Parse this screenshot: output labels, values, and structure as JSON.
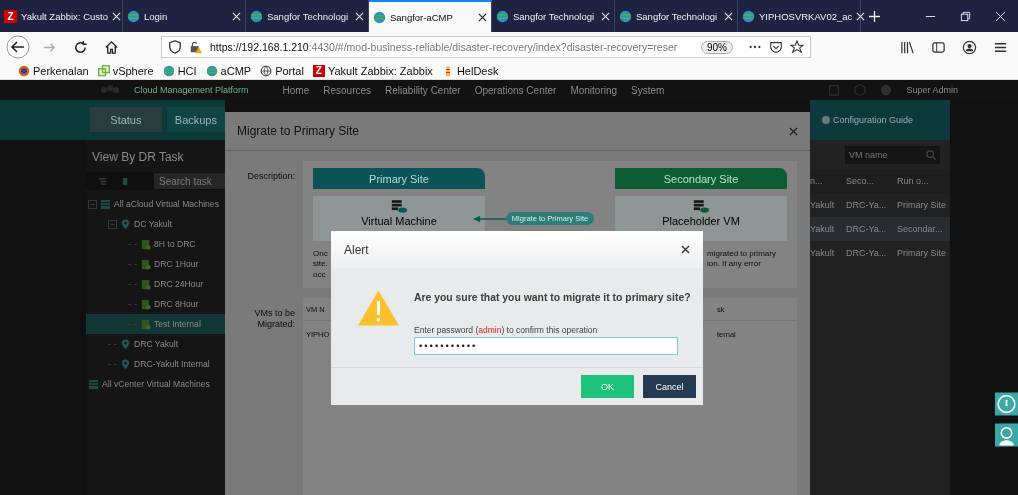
{
  "browser": {
    "tabs": [
      {
        "title": "Yakult Zabbix: Custo",
        "letter": "Z",
        "selected": false
      },
      {
        "title": "Login",
        "selected": false
      },
      {
        "title": "Sangfor Technologi",
        "selected": false
      },
      {
        "title": "Sangfor-aCMP",
        "selected": true
      },
      {
        "title": "Sangfor Technologi",
        "selected": false
      },
      {
        "title": "Sangfor Technologi",
        "selected": false
      },
      {
        "title": "YIPHOSVRKAV02_ac",
        "selected": false
      }
    ],
    "url_host": "https://192.168.1.210",
    "url_rest": ":4430/#/mod-business-reliable/disaster-recovery/index?disaster-recovery=reser",
    "zoom": "90%",
    "bookmarks": [
      {
        "label": "Perkenalan"
      },
      {
        "label": "vSphere"
      },
      {
        "label": "HCI"
      },
      {
        "label": "aCMP"
      },
      {
        "label": "Portal"
      },
      {
        "label": "Yakult Zabbix: Zabbix",
        "letter": "Z"
      },
      {
        "label": "HelDesk"
      }
    ]
  },
  "app": {
    "brand_subtitle": "Cloud Management Platform",
    "nav": [
      "Home",
      "Resources",
      "Reliability Center",
      "Operations Center",
      "Monitoring",
      "System"
    ],
    "user": "Super Admin",
    "tabs": [
      {
        "label": "Status",
        "selected": true
      },
      {
        "label": "Backups",
        "selected": false
      }
    ],
    "guide": "Configuration Guide",
    "panel_title": "View By DR Task",
    "search_placeholder": "Search task",
    "tree": [
      {
        "label": "All aCloud Virtual Machines",
        "kind": "group",
        "selected": false,
        "children": [
          {
            "label": "DC Yakult",
            "kind": "site",
            "selected": false,
            "children": [
              {
                "label": "8H to DRC",
                "kind": "task",
                "selected": false
              },
              {
                "label": "DRC 1Hour",
                "kind": "task",
                "selected": false
              },
              {
                "label": "DRC 24Hour",
                "kind": "task",
                "selected": false
              },
              {
                "label": "DRC 8Hour",
                "kind": "task",
                "selected": false
              },
              {
                "label": "Test Internal",
                "kind": "task",
                "selected": true
              }
            ]
          },
          {
            "label": "DRC Yakult",
            "kind": "site",
            "selected": false
          },
          {
            "label": "DRC-Yakult Internal",
            "kind": "site",
            "selected": false
          }
        ]
      },
      {
        "label": "All vCenter Virtual Machines",
        "kind": "group",
        "selected": false
      }
    ],
    "table": {
      "search_placeholder": "VM name",
      "columns": [
        "n...",
        "Seco...",
        "Run o..."
      ],
      "rows": [
        {
          "cells": [
            "Yakult",
            "DRC-Ya...",
            "Primary Site"
          ],
          "selected": false
        },
        {
          "cells": [
            "Yakult",
            "DRC-Ya...",
            "Secondar..."
          ],
          "selected": true
        },
        {
          "cells": [
            "Yakult",
            "DRC-Ya...",
            "Primary Site"
          ],
          "selected": false
        }
      ]
    }
  },
  "modal": {
    "title": "Migrate to Primary Site",
    "description_label": "Description:",
    "primary_site": "Primary Site",
    "secondary_site": "Secondary Site",
    "source": "Virtual Machine",
    "target": "Placeholder VM",
    "flow_label": "Migrate to Primary Site",
    "text_left": [
      "Onc",
      "site.",
      "occ"
    ],
    "text_right": [
      "migrated to primary",
      "ion. If any error"
    ],
    "vms_label": "VMs to be Migrated:",
    "table": {
      "columns": [
        "VM N",
        "sk"
      ],
      "rows": [
        [
          "YIPHO",
          "ternal"
        ]
      ]
    }
  },
  "alert": {
    "title": "Alert",
    "question": "Are you sure that you want to migrate it to primary site?",
    "prompt_before": "Enter password (",
    "prompt_user": "admin",
    "prompt_after": ") to confirm this operation",
    "password": "•••••••••••",
    "buttons": [
      {
        "label": "OK",
        "kind": "primary"
      },
      {
        "label": "Cancel",
        "kind": "secondary"
      }
    ]
  }
}
